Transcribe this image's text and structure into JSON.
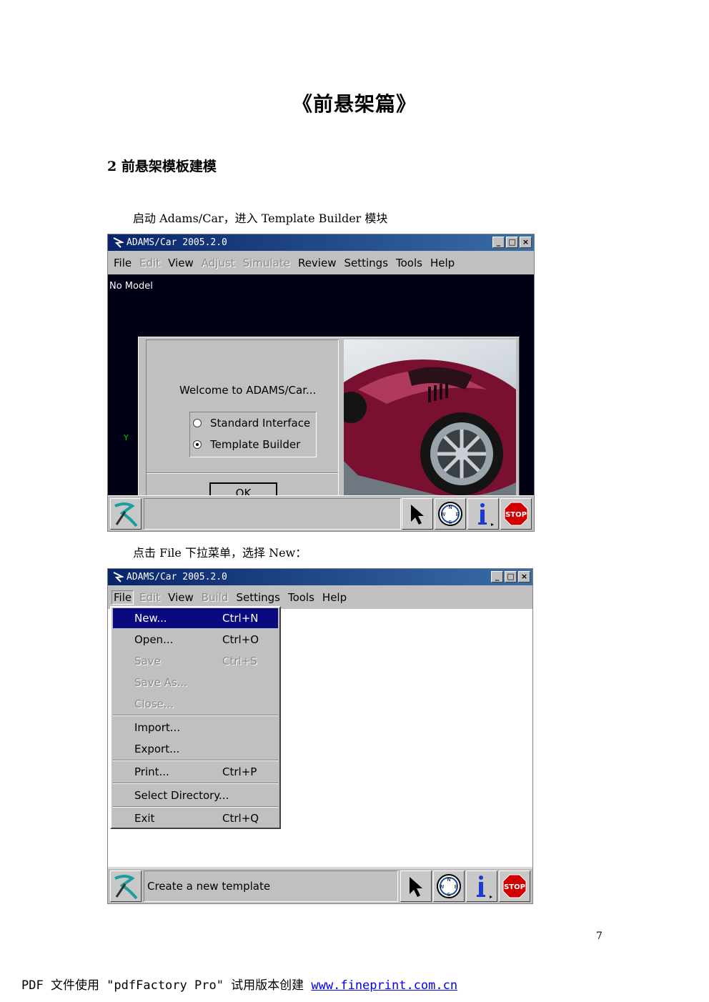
{
  "page": {
    "title": "《前悬架篇》",
    "section_heading": "2 前悬架模板建模",
    "para1": "启动 Adams/Car，进入 Template Builder 模块",
    "para2": "点击 File 下拉菜单，选择 New：",
    "page_number": "7",
    "footer_text": "PDF 文件使用 \"pdfFactory Pro\" 试用版本创建 ",
    "footer_link": "www.fineprint.com.cn"
  },
  "window1": {
    "title": "ADAMS/Car 2005.2.0",
    "menu": [
      {
        "label": "File",
        "enabled": true
      },
      {
        "label": "Edit",
        "enabled": false
      },
      {
        "label": "View",
        "enabled": true
      },
      {
        "label": "Adjust",
        "enabled": false
      },
      {
        "label": "Simulate",
        "enabled": false
      },
      {
        "label": "Review",
        "enabled": true
      },
      {
        "label": "Settings",
        "enabled": true
      },
      {
        "label": "Tools",
        "enabled": true
      },
      {
        "label": "Help",
        "enabled": true
      }
    ],
    "viewport_label": "No Model",
    "axis_label": "Y",
    "dialog": {
      "welcome": "Welcome to ADAMS/Car...",
      "options": [
        "Standard Interface",
        "Template Builder"
      ],
      "selected": "Template Builder",
      "ok": "OK"
    },
    "status_text": ""
  },
  "window2": {
    "title": "ADAMS/Car 2005.2.0",
    "menu": [
      {
        "label": "File",
        "enabled": true
      },
      {
        "label": "Edit",
        "enabled": false
      },
      {
        "label": "View",
        "enabled": true
      },
      {
        "label": "Build",
        "enabled": false
      },
      {
        "label": "Settings",
        "enabled": true
      },
      {
        "label": "Tools",
        "enabled": true
      },
      {
        "label": "Help",
        "enabled": true
      }
    ],
    "file_menu": [
      {
        "label": "New...",
        "shortcut": "Ctrl+N",
        "state": "highlighted"
      },
      {
        "label": "Open...",
        "shortcut": "Ctrl+O",
        "state": "enabled"
      },
      {
        "label": "Save",
        "shortcut": "Ctrl+S",
        "state": "disabled"
      },
      {
        "label": "Save As...",
        "shortcut": "",
        "state": "disabled"
      },
      {
        "label": "Close...",
        "shortcut": "",
        "state": "disabled"
      },
      {
        "label": "Import...",
        "shortcut": "",
        "state": "enabled"
      },
      {
        "label": "Export...",
        "shortcut": "",
        "state": "enabled"
      },
      {
        "label": "Print...",
        "shortcut": "Ctrl+P",
        "state": "enabled"
      },
      {
        "label": "Select Directory...",
        "shortcut": "",
        "state": "enabled"
      },
      {
        "label": "Exit",
        "shortcut": "Ctrl+Q",
        "state": "enabled"
      }
    ],
    "status_text": "Create a new template"
  },
  "icons": [
    "adams-logo-icon",
    "select-arrow-icon",
    "compass-icon",
    "info-icon",
    "stop-icon"
  ],
  "colors": {
    "titlebar": "#08246b",
    "highlight": "#0a0a80",
    "stop": "#d00000",
    "link": "#0000ee"
  }
}
